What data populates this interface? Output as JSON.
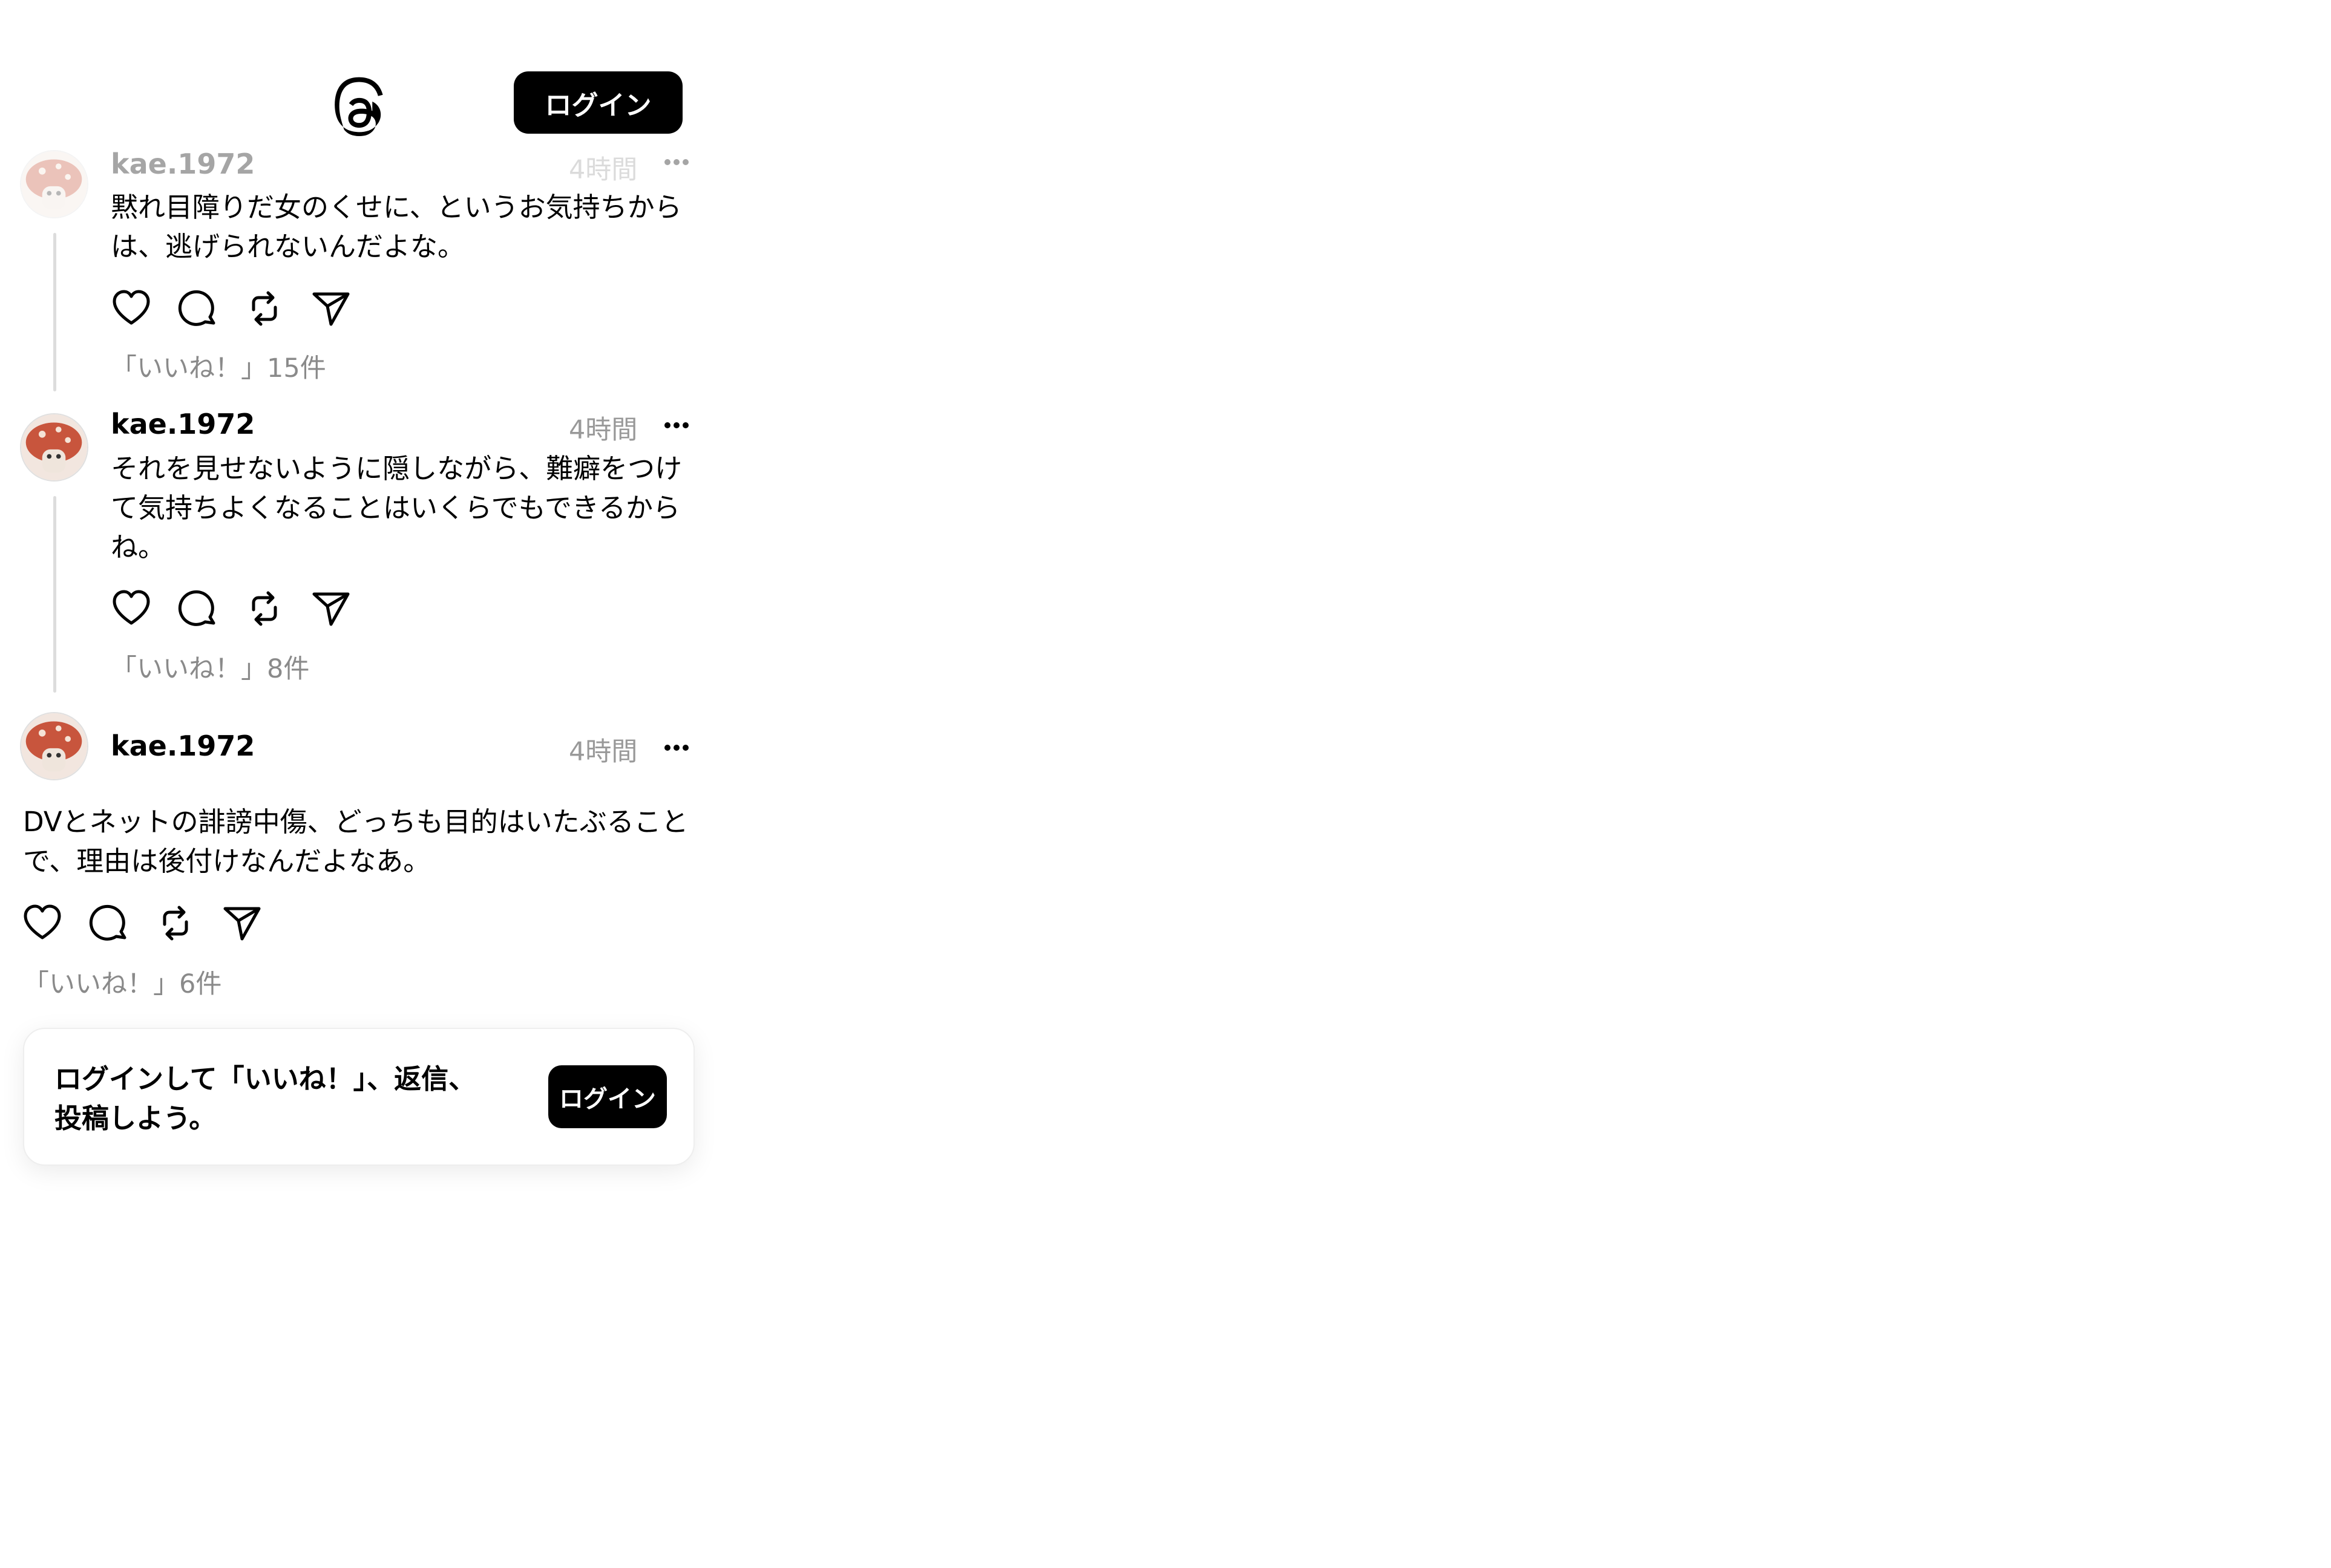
{
  "header": {
    "logo_icon": "threads-logo-icon",
    "login_label": "ログイン"
  },
  "posts": [
    {
      "username": "kae.1972",
      "time": "4時間",
      "text": "黙れ目障りだ女のくせに、というお気持ちからは、逃げられないんだよな。",
      "likes": "「いいね！」15件"
    },
    {
      "username": "kae.1972",
      "time": "4時間",
      "text": "それを見せないように隠しながら、難癖をつけて気持ちよくなることはいくらでもできるからね。",
      "likes": "「いいね！」8件"
    },
    {
      "username": "kae.1972",
      "time": "4時間",
      "text": "DVとネットの誹謗中傷、どっちも目的はいたぶることで、理由は後付けなんだよなあ。",
      "likes": "「いいね！」6件"
    }
  ],
  "actions": [
    "heart-icon",
    "comment-icon",
    "repost-icon",
    "share-icon"
  ],
  "login_card": {
    "text": "ログインして「いいね！」、返信、投稿しよう。",
    "button_label": "ログイン"
  }
}
